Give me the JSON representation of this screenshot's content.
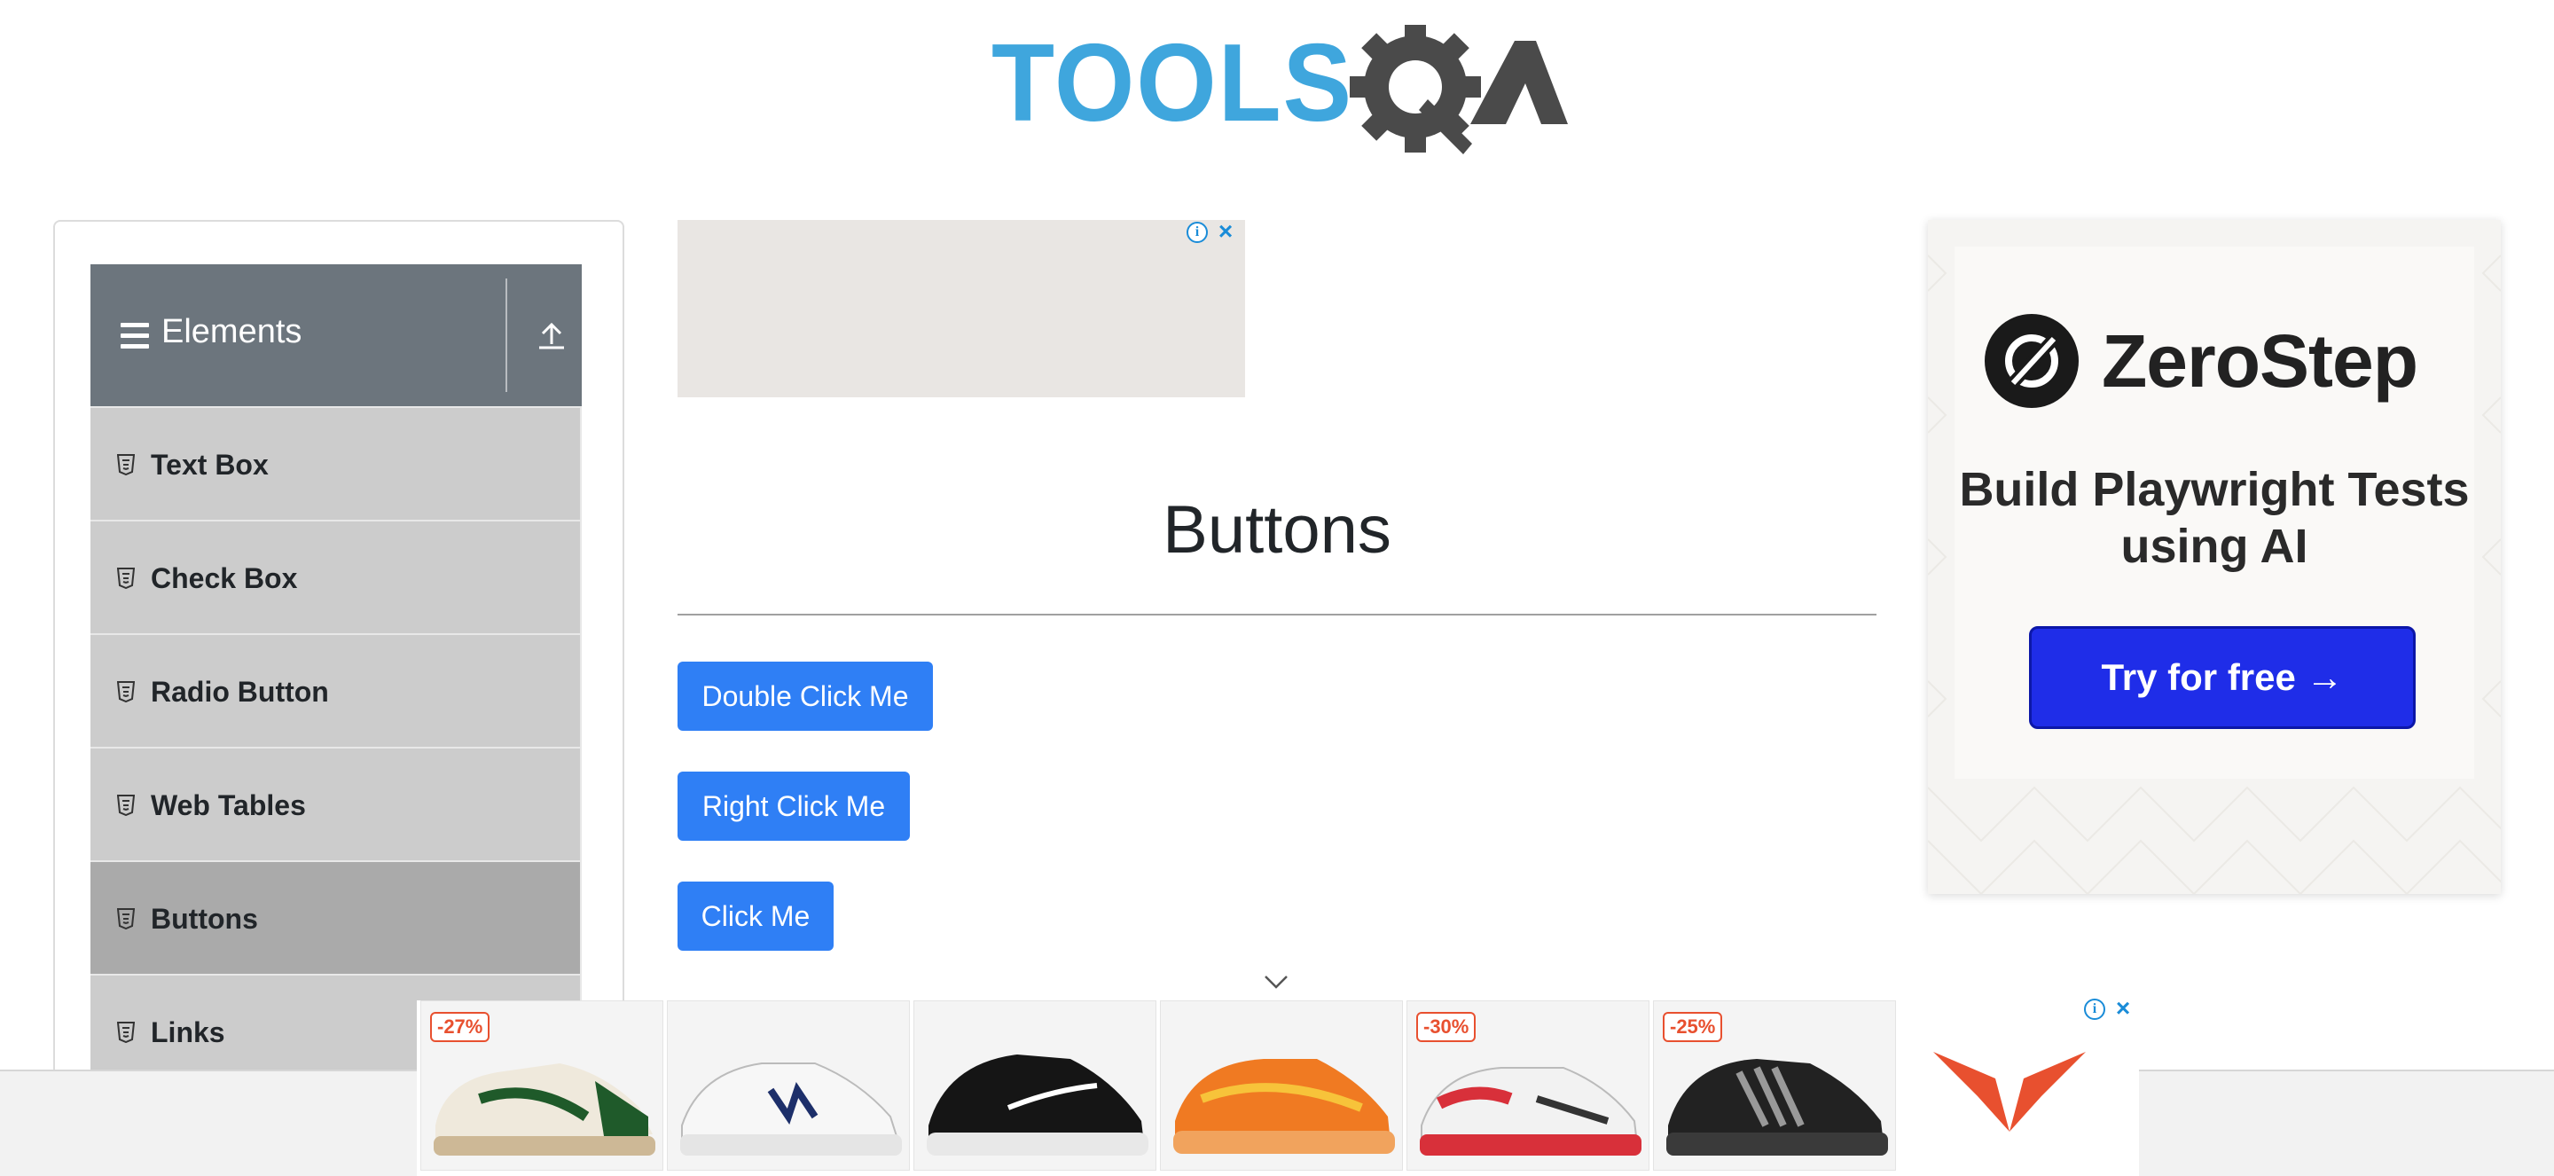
{
  "header": {
    "logo_text": "TOOLSQA"
  },
  "sidebar": {
    "group_title": "Elements",
    "items": [
      {
        "label": "Text Box"
      },
      {
        "label": "Check Box"
      },
      {
        "label": "Radio Button"
      },
      {
        "label": "Web Tables"
      },
      {
        "label": "Buttons",
        "active": true
      },
      {
        "label": "Links"
      }
    ]
  },
  "main": {
    "title": "Buttons",
    "buttons": {
      "double_click": "Double Click Me",
      "right_click": "Right Click Me",
      "click": "Click Me"
    }
  },
  "right_ad": {
    "brand": "ZeroStep",
    "tagline": "Build Playwright Tests using AI",
    "cta": "Try for free →"
  },
  "bottom_ad": {
    "products": [
      {
        "discount": "-27%",
        "color": "#1f5a2a"
      },
      {
        "discount": "",
        "color": "#1d2f6a"
      },
      {
        "discount": "",
        "color": "#111111"
      },
      {
        "discount": "",
        "color": "#f07a22"
      },
      {
        "discount": "-30%",
        "color": "#d8303a"
      },
      {
        "discount": "-25%",
        "color": "#222222"
      }
    ]
  },
  "colors": {
    "accent": "#2f7ff5",
    "sidebar_header": "#6c757d",
    "menu_item": "#cccccc",
    "menu_item_active": "#aaaaaa",
    "logo_blue": "#3fa6dd",
    "logo_gray": "#4a4a4a",
    "ad_cta": "#1f2de8",
    "discount": "#e8502f"
  }
}
